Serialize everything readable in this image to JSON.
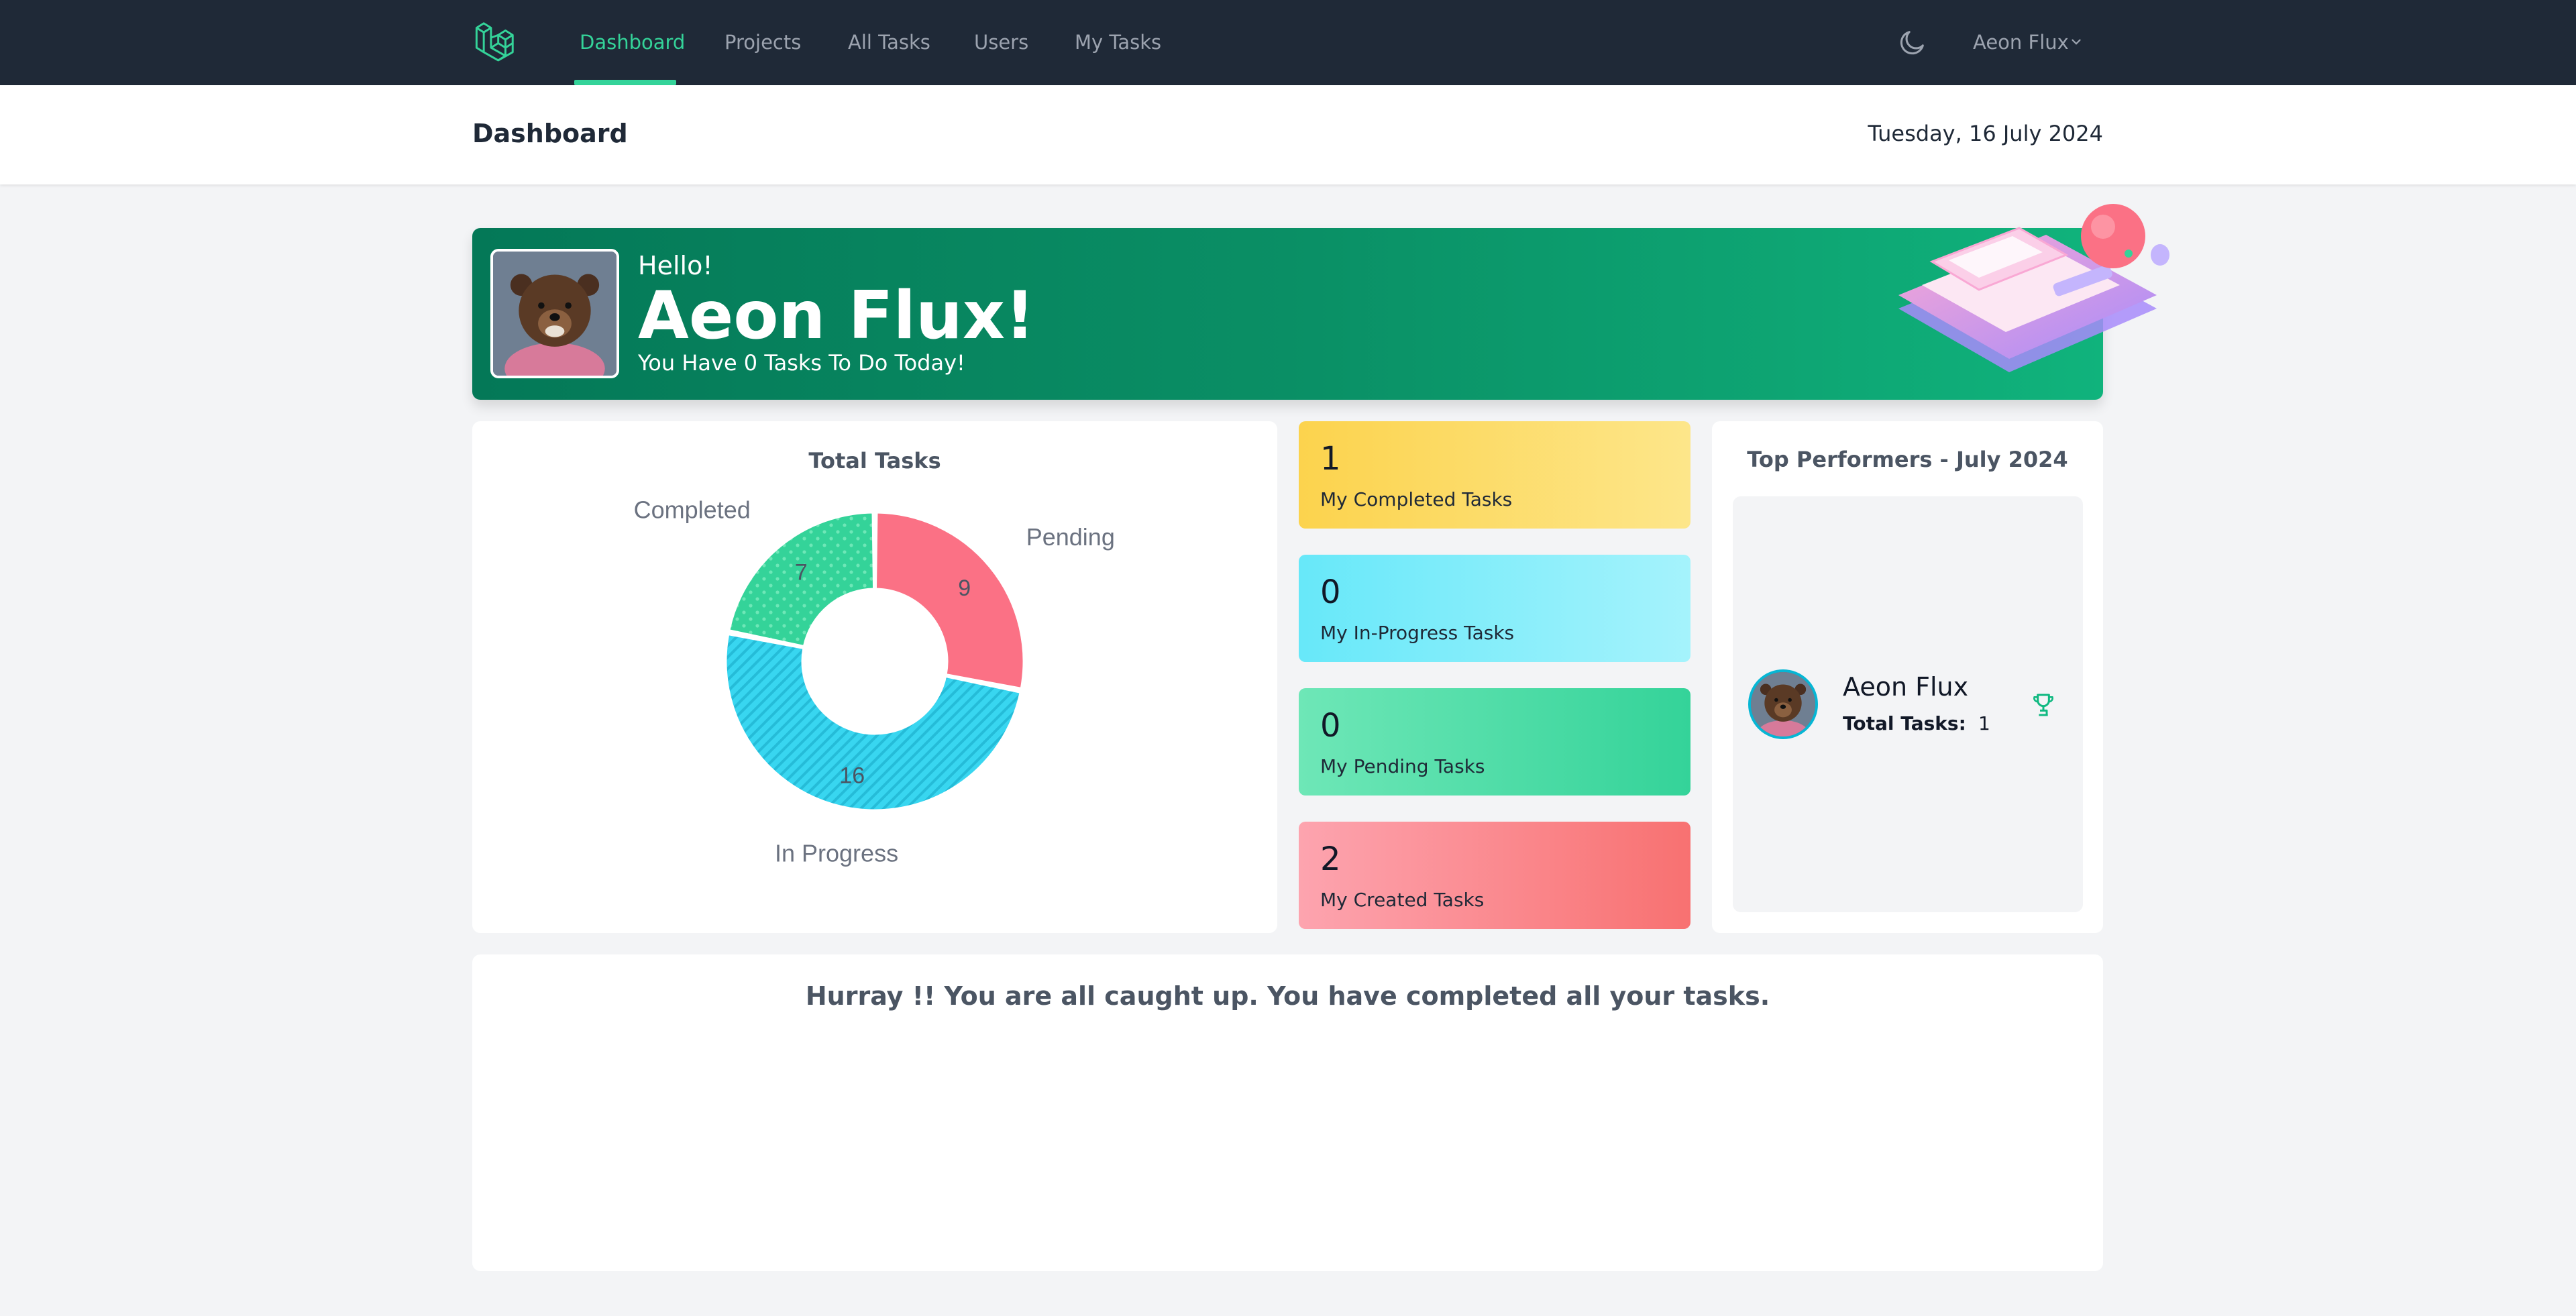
{
  "nav": {
    "links": [
      "Dashboard",
      "Projects",
      "All Tasks",
      "Users",
      "My Tasks"
    ],
    "active": "Dashboard",
    "user_menu": "Aeon Flux",
    "theme_icon": "moon-icon",
    "accent_color": "#34d399"
  },
  "header": {
    "title": "Dashboard",
    "date": "Tuesday, 16 July 2024"
  },
  "hero": {
    "hello": "Hello!",
    "name": "Aeon Flux!",
    "subtitle": "You Have 0 Tasks To Do Today!"
  },
  "chart_data": {
    "type": "pie",
    "title": "Total Tasks",
    "categories": [
      "Pending",
      "In Progress",
      "Completed"
    ],
    "values": [
      9,
      16,
      7
    ],
    "colors": [
      "#fb7185",
      "#38d6f0",
      "#34d399"
    ],
    "legend": "none"
  },
  "stats": [
    {
      "count": "1",
      "label": "My Completed Tasks"
    },
    {
      "count": "0",
      "label": "My In-Progress Tasks"
    },
    {
      "count": "0",
      "label": "My Pending Tasks"
    },
    {
      "count": "2",
      "label": "My Created Tasks"
    }
  ],
  "performers": {
    "title": "Top Performers - July 2024",
    "items": [
      {
        "name": "Aeon Flux",
        "total_label": "Total Tasks:",
        "total": "1",
        "icon": "trophy-icon"
      }
    ]
  },
  "message": "Hurray !! You are all caught up. You have completed all your tasks."
}
